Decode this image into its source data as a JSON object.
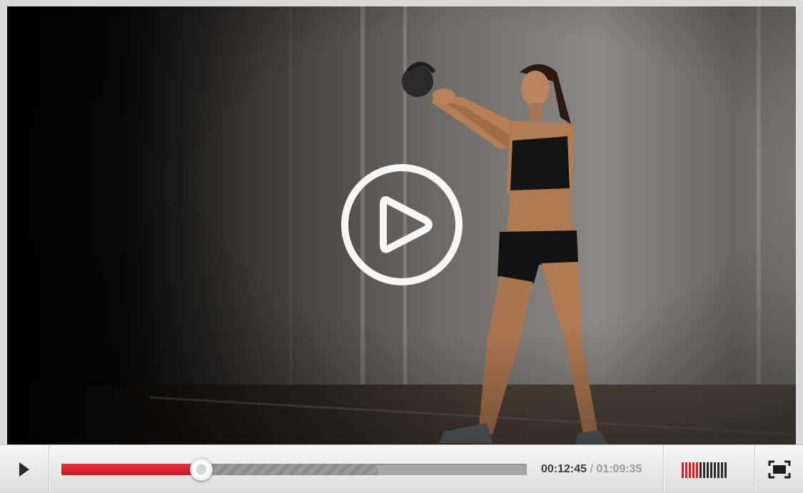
{
  "player": {
    "icons": {
      "big_play": "play-circle-icon",
      "control_play": "play-icon",
      "fullscreen": "fullscreen-icon",
      "volume": "volume-bars-icon"
    },
    "progress": {
      "played_fraction": 0.3,
      "buffered_fraction": 0.68
    },
    "time": {
      "current": "00:12:45",
      "separator": " / ",
      "total": "01:09:35"
    },
    "volume": {
      "level_bars": 5,
      "total_bars": 13
    },
    "colors": {
      "accent": "#d62028",
      "track": "#a7a7a7",
      "controls_bg": "#e6e6e6"
    }
  }
}
